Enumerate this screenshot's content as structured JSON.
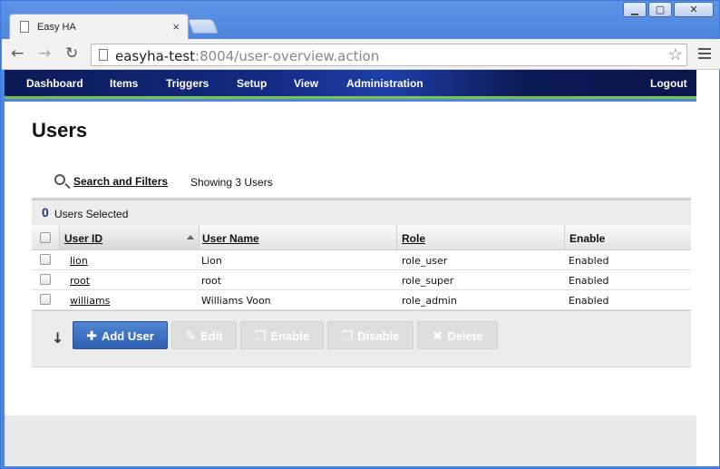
{
  "browser": {
    "tab_title": "Easy HA",
    "tab_close": "×",
    "url_host": "easyha-test",
    "url_rest": ":8004/user-overview.action",
    "window_buttons": {
      "minimize": "▁",
      "maximize": "▢",
      "close": "✕"
    }
  },
  "nav": {
    "items": [
      "Dashboard",
      "Items",
      "Triggers",
      "Setup",
      "View",
      "Administration"
    ],
    "logout": "Logout"
  },
  "page": {
    "title": "Users",
    "search_link": "Search and Filters",
    "showing": "Showing 3 Users"
  },
  "grid": {
    "selected_count": "0",
    "selected_label": "Users Selected",
    "columns": [
      "User ID",
      "User Name",
      "Role",
      "Enable"
    ],
    "rows": [
      {
        "user_id": "lion",
        "user_name": "Lion",
        "role": "role_user",
        "enable": "Enabled"
      },
      {
        "user_id": "root",
        "user_name": "root",
        "role": "role_super",
        "enable": "Enabled"
      },
      {
        "user_id": "williams",
        "user_name": "Williams Voon",
        "role": "role_admin",
        "enable": "Enabled"
      }
    ]
  },
  "actions": {
    "add": "Add User",
    "edit": "Edit",
    "enable": "Enable",
    "disable": "Disable",
    "delete": "Delete"
  },
  "colors": {
    "nav_accent": "#7cc24a",
    "primary_button": "#3a6fc4",
    "nav_bg": "#142c86"
  }
}
